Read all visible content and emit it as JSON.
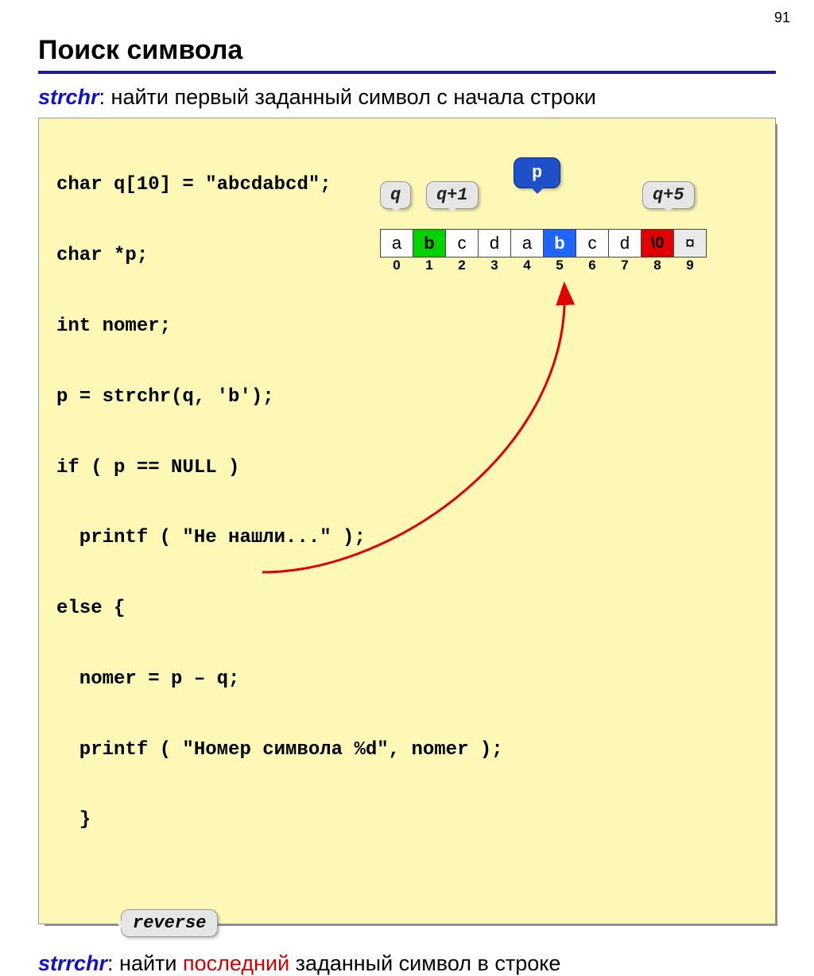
{
  "page_number": "91",
  "title": "Поиск символа",
  "intro": {
    "keyword": "strchr",
    "rest": ": найти первый заданный символ c начала строки"
  },
  "code": {
    "l1": "char q[10] = \"abcdabcd\";",
    "l2": "char *p;",
    "l3": "int nomer;",
    "l4": "p = strchr(q, 'b');",
    "l5": "if ( p == NULL )",
    "l6": "  printf ( \"Не нашли...\" );",
    "l7": "else {",
    "l8": "  nomer = p – q;",
    "l9": "  printf ( \"Номер символа %d\", nomer );",
    "l10": "  }"
  },
  "labels": {
    "q": "q",
    "q1": "q+1",
    "p": "p",
    "q5": "q+5",
    "reverse": "reverse"
  },
  "array": {
    "cells": [
      "a",
      "b",
      "c",
      "d",
      "a",
      "b",
      "c",
      "d",
      "\\0",
      "¤"
    ],
    "highlight": {
      "1": "green",
      "5": "blue",
      "8": "red",
      "9": "gray"
    },
    "indices": [
      "0",
      "1",
      "2",
      "3",
      "4",
      "5",
      "6",
      "7",
      "8",
      "9"
    ]
  },
  "footer": {
    "keyword": "strrchr",
    "before_red": ": найти ",
    "red": "последний",
    "after_red": " заданный символ в строке"
  }
}
